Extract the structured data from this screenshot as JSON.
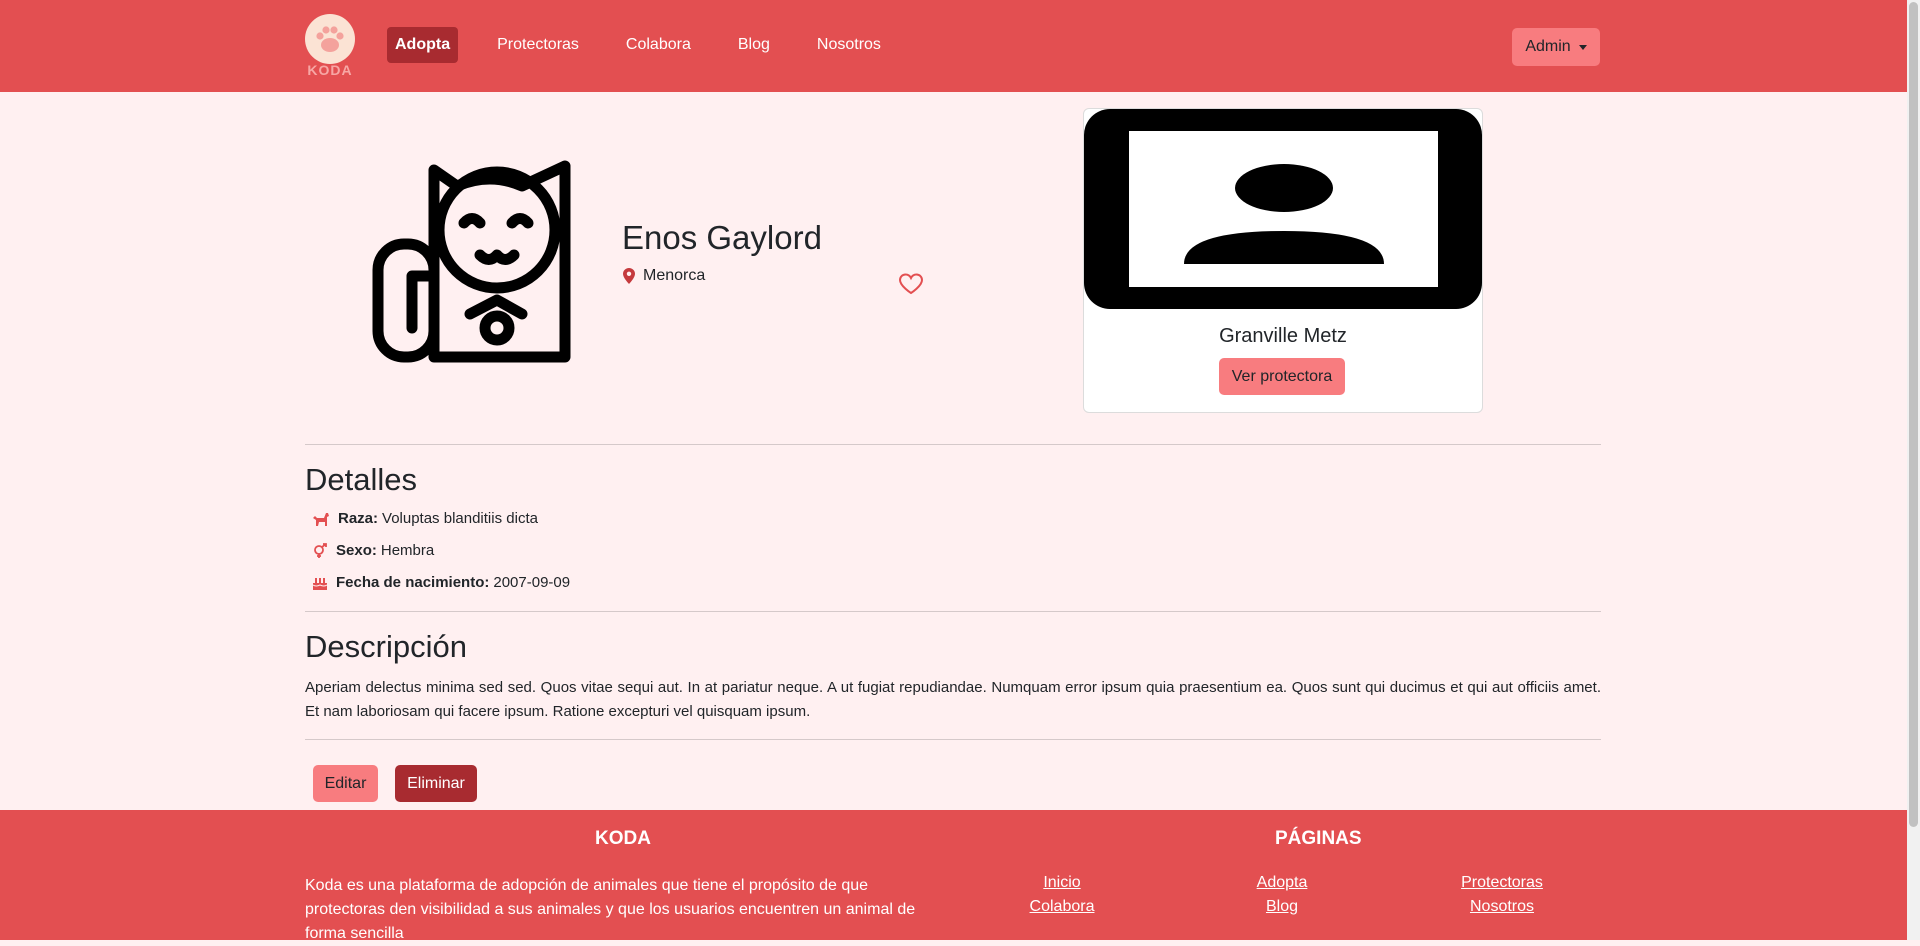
{
  "nav": {
    "logo_text": "KODA",
    "links": [
      "Adopta",
      "Protectoras",
      "Colabora",
      "Blog",
      "Nosotros"
    ],
    "active": "Adopta",
    "admin_label": "Admin"
  },
  "pet": {
    "name": "Enos Gaylord",
    "location": "Menorca",
    "image_icon": "lucky-cat-icon"
  },
  "shelter": {
    "name": "Granville Metz",
    "button_label": "Ver protectora",
    "image_icon": "user-placeholder-icon"
  },
  "details": {
    "title": "Detalles",
    "items": [
      {
        "icon": "dog-icon",
        "label": "Raza:",
        "value": "Voluptas blanditiis dicta"
      },
      {
        "icon": "gender-icon",
        "label": "Sexo:",
        "value": "Hembra"
      },
      {
        "icon": "cake-icon",
        "label": "Fecha de nacimiento:",
        "value": "2007-09-09"
      }
    ]
  },
  "description": {
    "title": "Descripción",
    "text": "Aperiam delectus minima sed sed. Quos vitae sequi aut. In at pariatur neque. A ut fugiat repudiandae. Numquam error ipsum quia praesentium ea. Quos sunt qui ducimus et qui aut officiis amet. Et nam laboriosam qui facere ipsum. Ratione excepturi vel quisquam ipsum."
  },
  "actions": {
    "edit_label": "Editar",
    "delete_label": "Eliminar"
  },
  "footer": {
    "brand_title": "KODA",
    "brand_text": "Koda es una plataforma de adopción de animales que tiene el propósito de que protectoras den visibilidad a sus animales y que los usuarios encuentren un animal de forma sencilla",
    "pages_title": "PÁGINAS",
    "links": [
      "Inicio",
      "Adopta",
      "Protectoras",
      "Colabora",
      "Blog",
      "Nosotros"
    ]
  },
  "colors": {
    "primary": "#e34f51",
    "accent": "#f87c7f",
    "dark": "#a82b30",
    "background": "#fff0f1"
  }
}
